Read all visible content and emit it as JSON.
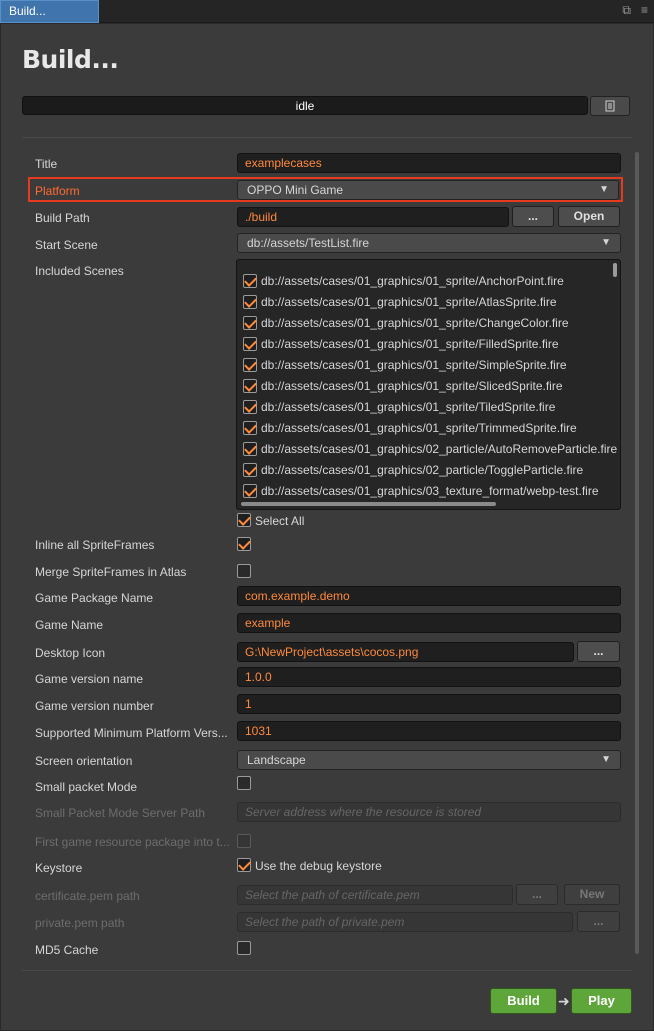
{
  "window": {
    "tab_title": "Build..."
  },
  "heading": "Build...",
  "progress": {
    "status": "idle"
  },
  "colors": {
    "accent": "#ff8a3c",
    "highlight": "#e53a1e",
    "build_button": "#5fa63a"
  },
  "fields": {
    "title": {
      "label": "Title",
      "value": "examplecases"
    },
    "platform": {
      "label": "Platform",
      "value": "OPPO Mini Game"
    },
    "build_path": {
      "label": "Build Path",
      "value": "./build",
      "browse": "...",
      "open": "Open"
    },
    "start_scene": {
      "label": "Start Scene",
      "value": "db://assets/TestList.fire"
    },
    "included_scenes": {
      "label": "Included Scenes",
      "items": [
        "db://assets/cases/01_graphics/01_sprite/AnchorPoint.fire",
        "db://assets/cases/01_graphics/01_sprite/AtlasSprite.fire",
        "db://assets/cases/01_graphics/01_sprite/ChangeColor.fire",
        "db://assets/cases/01_graphics/01_sprite/FilledSprite.fire",
        "db://assets/cases/01_graphics/01_sprite/SimpleSprite.fire",
        "db://assets/cases/01_graphics/01_sprite/SlicedSprite.fire",
        "db://assets/cases/01_graphics/01_sprite/TiledSprite.fire",
        "db://assets/cases/01_graphics/01_sprite/TrimmedSprite.fire",
        "db://assets/cases/01_graphics/02_particle/AutoRemoveParticle.fire",
        "db://assets/cases/01_graphics/02_particle/ToggleParticle.fire",
        "db://assets/cases/01_graphics/03_texture_format/webp-test.fire"
      ],
      "select_all": "Select All"
    },
    "inline_spriteframes": {
      "label": "Inline all SpriteFrames",
      "checked": true
    },
    "merge_spriteframes": {
      "label": "Merge SpriteFrames in Atlas",
      "checked": false
    },
    "package_name": {
      "label": "Game Package Name",
      "value": "com.example.demo"
    },
    "game_name": {
      "label": "Game Name",
      "value": "example"
    },
    "desktop_icon": {
      "label": "Desktop Icon",
      "value": "G:\\NewProject\\assets\\cocos.png",
      "browse": "..."
    },
    "version_name": {
      "label": "Game version name",
      "value": "1.0.0"
    },
    "version_number": {
      "label": "Game version number",
      "value": "1"
    },
    "min_platform": {
      "label": "Supported Minimum Platform Vers...",
      "value": "1031"
    },
    "orientation": {
      "label": "Screen orientation",
      "value": "Landscape"
    },
    "small_packet": {
      "label": "Small packet Mode",
      "checked": false
    },
    "small_packet_server": {
      "label": "Small Packet Mode Server Path",
      "placeholder": "Server address where the resource is stored"
    },
    "first_package": {
      "label": "First game resource package into t...",
      "checked": false
    },
    "keystore": {
      "label": "Keystore",
      "checked": true,
      "option": "Use the debug keystore"
    },
    "certificate": {
      "label": "certificate.pem path",
      "placeholder": "Select the path of certificate.pem",
      "browse": "...",
      "new": "New"
    },
    "private_pem": {
      "label": "private.pem path",
      "placeholder": "Select the path of private.pem",
      "browse": "..."
    },
    "md5_cache": {
      "label": "MD5 Cache",
      "checked": false
    }
  },
  "footer": {
    "build": "Build",
    "play": "Play"
  }
}
